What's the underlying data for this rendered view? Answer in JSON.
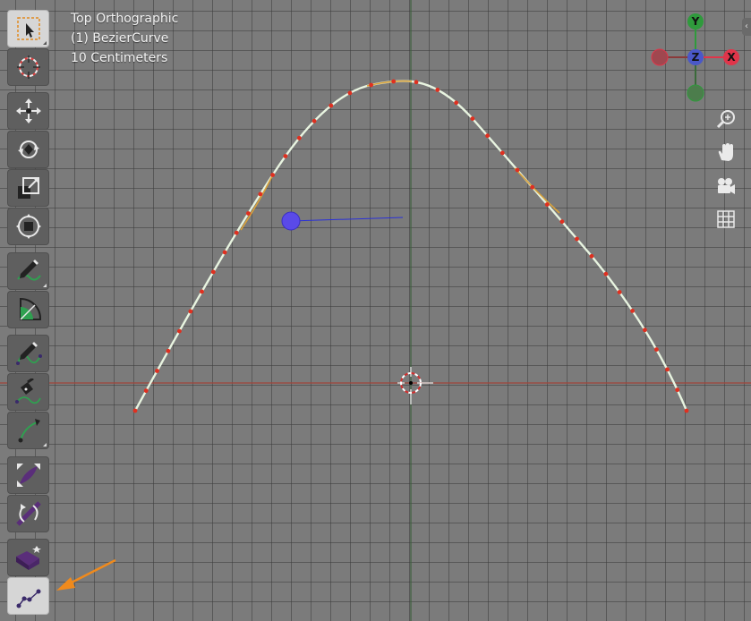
{
  "viewport": {
    "view_name": "Top Orthographic",
    "object_name": "(1) BezierCurve",
    "scale_label": "10 Centimeters"
  },
  "gizmo": {
    "y_label": "Y",
    "z_label": "Z",
    "x_label": "X",
    "colors": {
      "x": "#e0354a",
      "y": "#2f9a3c",
      "z": "#4a58c8"
    }
  },
  "toolbar": {
    "tools": [
      {
        "name": "select-box",
        "active": true
      },
      {
        "name": "cursor",
        "active": false
      },
      {
        "name": "move",
        "active": false
      },
      {
        "name": "rotate",
        "active": false
      },
      {
        "name": "scale",
        "active": false
      },
      {
        "name": "transform",
        "active": false
      },
      {
        "name": "annotate",
        "active": false
      },
      {
        "name": "measure",
        "active": false
      },
      {
        "name": "draw",
        "active": false
      },
      {
        "name": "pen",
        "active": false
      },
      {
        "name": "extrude-cursor",
        "active": false
      },
      {
        "name": "radius",
        "active": false
      },
      {
        "name": "tilt",
        "active": false
      },
      {
        "name": "randomize",
        "active": false
      },
      {
        "name": "curve-node",
        "active": true
      }
    ]
  },
  "nav": {
    "icons": [
      "zoom-icon",
      "pan-hand-icon",
      "camera-icon",
      "ortho-grid-icon"
    ]
  },
  "colors": {
    "curve": "#e8f4e0",
    "curve_segment": "#d9a23a",
    "control_point": "#e03020",
    "x_axis": "#a0443a",
    "y_axis": "#3e5e3e",
    "annotation_arrow": "#f08a1c",
    "handle_sphere": "#5a4ae8"
  }
}
